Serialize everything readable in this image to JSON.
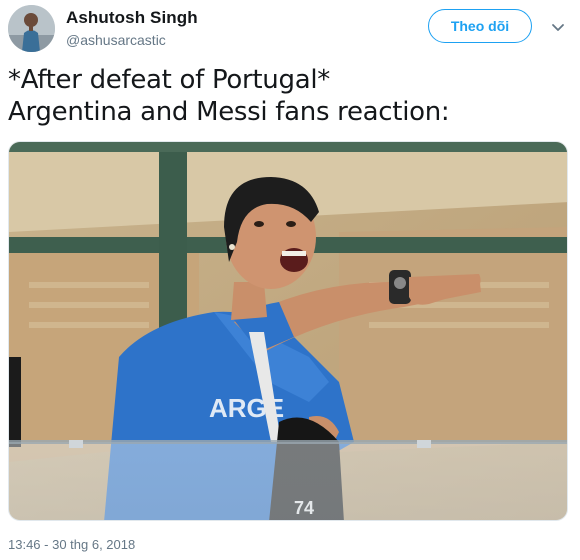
{
  "author": {
    "name": "Ashutosh Singh",
    "handle": "@ashusarcastic"
  },
  "follow_button": {
    "label": "Theo dõi"
  },
  "tweet": {
    "lines": [
      "*After defeat of Portugal*",
      "Argentina and Messi fans reaction:"
    ]
  },
  "timestamp": "13:46 - 30 thg 6, 2018",
  "icons": {
    "more": "chevron-down-icon"
  },
  "colors": {
    "accent": "#1da1f2",
    "text": "#14171a",
    "secondary": "#657786"
  }
}
